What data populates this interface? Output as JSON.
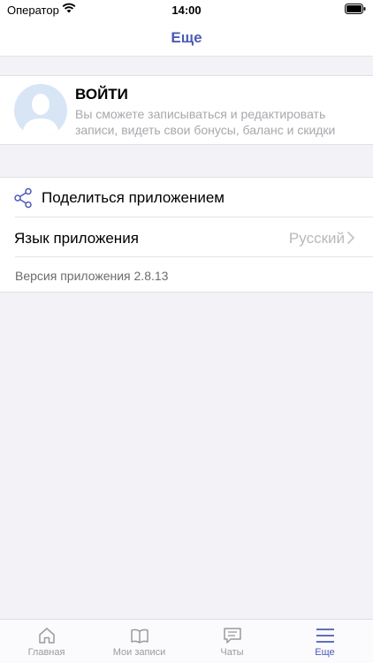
{
  "status_bar": {
    "carrier": "Оператор",
    "time": "14:00"
  },
  "nav": {
    "title": "Еще"
  },
  "profile": {
    "title": "ВОЙТИ",
    "description": "Вы сможете записываться и редактировать записи, видеть свои бонусы, баланс и скидки"
  },
  "menu": {
    "share_label": "Поделиться приложением",
    "language_label": "Язык приложения",
    "language_value": "Русский",
    "version_label": "Версия приложения 2.8.13"
  },
  "tabs": [
    {
      "label": "Главная",
      "icon": "home-icon",
      "active": false
    },
    {
      "label": "Мои записи",
      "icon": "book-icon",
      "active": false
    },
    {
      "label": "Чаты",
      "icon": "chat-icon",
      "active": false
    },
    {
      "label": "Еще",
      "icon": "menu-icon",
      "active": true
    }
  ],
  "colors": {
    "accent": "#4a5bb5",
    "muted": "#9a9aa0",
    "background": "#f2f2f7"
  }
}
